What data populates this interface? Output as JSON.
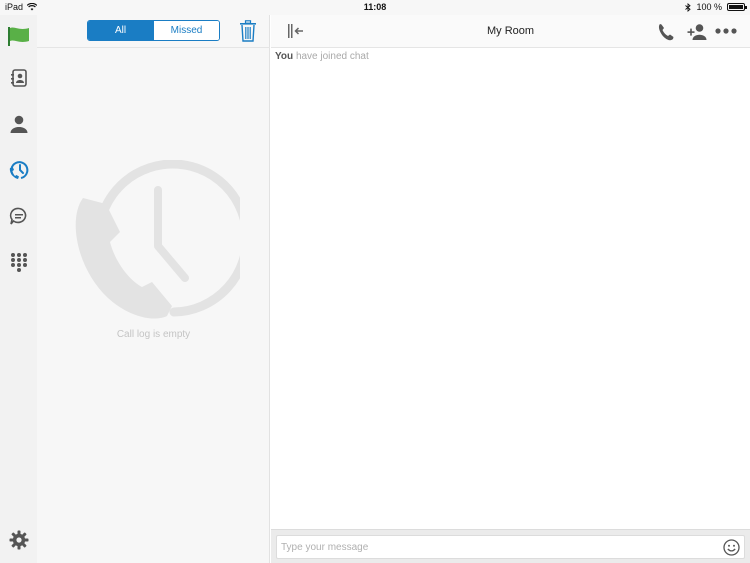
{
  "status_bar": {
    "device": "iPad",
    "time": "11:08",
    "battery": "100 %"
  },
  "colors": {
    "accent": "#1a7dc4",
    "flag": "#59b047",
    "rail_bg": "#f2f2f2",
    "muted_text": "#c4c4c4"
  },
  "rail": {
    "items": [
      {
        "icon": "green-flag-icon"
      },
      {
        "icon": "contacts-directory-icon"
      },
      {
        "icon": "person-icon"
      },
      {
        "icon": "recent-calls-icon",
        "active": true
      },
      {
        "icon": "chat-bubble-icon"
      },
      {
        "icon": "dialpad-icon"
      },
      {
        "icon": "gear-icon"
      }
    ]
  },
  "call_log": {
    "filter": {
      "all_label": "All",
      "missed_label": "Missed",
      "selected": "All"
    },
    "empty_text": "Call log is empty"
  },
  "chat": {
    "title": "My Room",
    "system_message": {
      "actor": "You",
      "text": "have joined chat"
    },
    "composer": {
      "placeholder": "Type your message"
    }
  }
}
